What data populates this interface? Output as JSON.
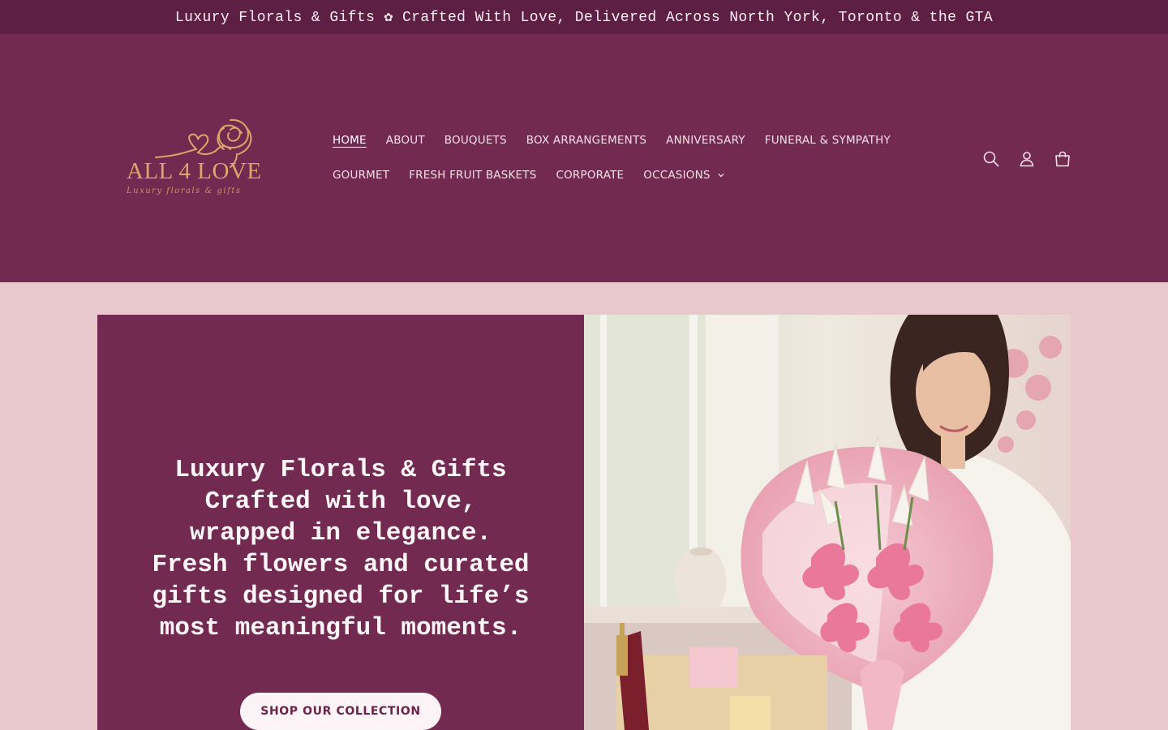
{
  "announcement": {
    "text": "Luxury Florals & Gifts ✿ Crafted With Love, Delivered Across North York, Toronto & the GTA"
  },
  "logo": {
    "brand": "ALL 4 LOVE",
    "tagline": "Luxury florals & gifts",
    "icon": "rose-heart-logo"
  },
  "nav": {
    "row1": [
      {
        "label": "HOME",
        "active": true
      },
      {
        "label": "ABOUT"
      },
      {
        "label": "BOUQUETS"
      },
      {
        "label": "BOX ARRANGEMENTS"
      },
      {
        "label": "ANNIVERSARY"
      },
      {
        "label": "FUNERAL & SYMPATHY"
      }
    ],
    "row2": [
      {
        "label": "GOURMET"
      },
      {
        "label": "FRESH FRUIT BASKETS"
      },
      {
        "label": "CORPORATE"
      },
      {
        "label": "OCCASIONS",
        "icon": "chevron-down-icon"
      }
    ]
  },
  "header_icons": [
    "search-icon",
    "account-icon",
    "cart-icon"
  ],
  "hero": {
    "text": "Luxury Florals & Gifts Crafted with love, wrapped in elegance. Fresh flowers and curated gifts designed for life’s most meaningful moments.",
    "button_label": "SHOP OUR COLLECTION",
    "image_alt": "Woman holding pink lily bouquet with gift basket"
  },
  "colors": {
    "announcement_bg": "#5e1f45",
    "header_bg": "#732a50",
    "page_bg": "#e8c7cd",
    "accent_gold": "#d6a56b",
    "button_bg": "#fbf3f5",
    "button_text": "#6b2448"
  }
}
